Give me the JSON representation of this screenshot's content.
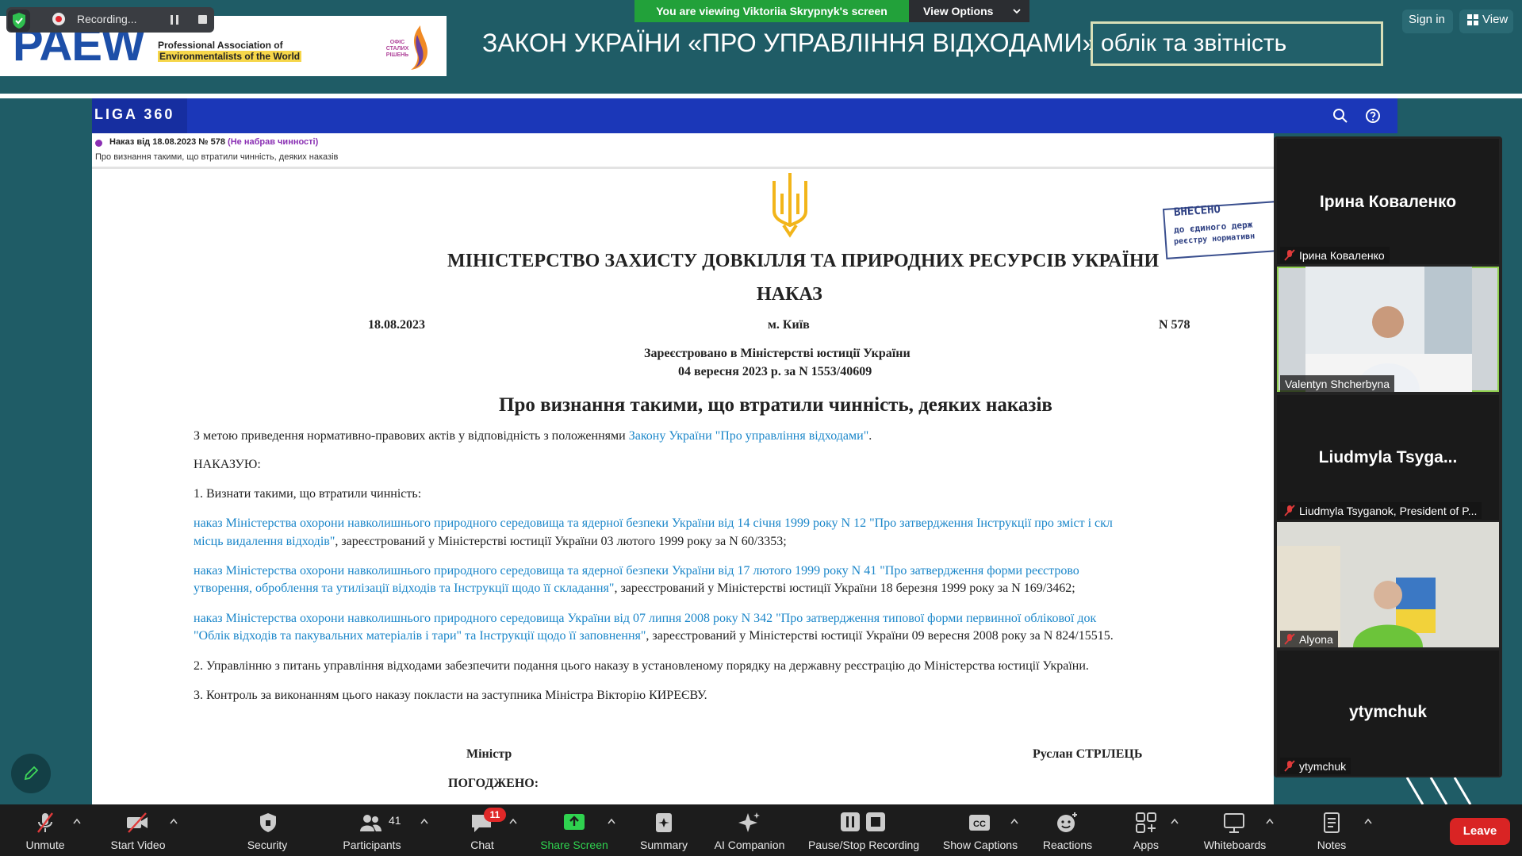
{
  "slide": {
    "logo_text": "PAEW",
    "logo_sub_1": "Professional Association of",
    "logo_sub_2": "Environmentalists of the World",
    "partner_logo_text": "ОФІС СТАЛИХ РІШЕНЬ",
    "title": "ЗАКОН УКРАЇНИ «ПРО УПРАВЛІННЯ ВІДХОДАМИ»:",
    "subtitle": "облік та звітність"
  },
  "overlay": {
    "recording_label": "Recording...",
    "viewing_text": "You are viewing Viktoriia Skrypnyk's screen",
    "view_options_label": "View Options",
    "sign_in_label": "Sign in",
    "view_label": "View"
  },
  "liga": {
    "brand": "LIGA 360",
    "order_line": "Наказ від 18.08.2023 № 578",
    "order_status": "(Не набрав чинності)",
    "order_desc": "Про визнання такими, що втратили чинність, деяких наказів"
  },
  "document": {
    "ministry_title": "МІНІСТЕРСТВО ЗАХИСТУ ДОВКІЛЛЯ ТА ПРИРОДНИХ РЕСУРСІВ УКРАЇНИ",
    "nakaz_title": "НАКАЗ",
    "date": "18.08.2023",
    "city": "м. Київ",
    "number": "N 578",
    "reg_line1": "Зареєстровано в Міністерстві юстиції України",
    "reg_line2": "04 вересня 2023 р. за N 1553/40609",
    "heading": "Про визнання такими, що втратили чинність, деяких наказів",
    "p_intro_text": "З метою приведення нормативно-правових актів у відповідність з положеннями ",
    "p_intro_link": "Закону України \"Про управління відходами\"",
    "p_intro_end": ".",
    "p_nakazuyu": "НАКАЗУЮ:",
    "p_item1": "1. Визнати такими, що втратили чинність:",
    "p_a1_link": "наказ Міністерства охорони навколишнього природного середовища та ядерної безпеки України від 14 січня 1999 року N 12 \"Про затвердження Інструкції про зміст і скл",
    "p_a2_link": "місць видалення відходів\"",
    "p_a2_text": ", зареєстрований у Міністерстві юстиції України 03 лютого 1999 року за N 60/3353;",
    "p_b1_link": "наказ Міністерства охорони навколишнього природного середовища та ядерної безпеки України від 17 лютого 1999 року N 41 \"Про затвердження форми реєстрово",
    "p_b2_link": "утворення, оброблення та утилізації відходів та Інструкції щодо її складання\"",
    "p_b2_text": ", зареєстрований у Міністерстві юстиції України 18 березня 1999 року за N 169/3462;",
    "p_c1_link": "наказ Міністерства охорони навколишнього природного середовища України від 07 липня 2008 року N 342 \"Про затвердження типової форми первинної облікової док",
    "p_c2_link": "\"Облік відходів та пакувальних матеріалів і тари\" та Інструкції щодо її заповнення\"",
    "p_c2_text": ", зареєстрований у Міністерстві юстиції України 09 вересня 2008 року за N 824/15515.",
    "p_item2": "2. Управлінню з питань управління відходами забезпечити подання цього наказу в установленому порядку на державну реєстрацію до Міністерства юстиції України.",
    "p_item3": "3. Контроль за виконанням цього наказу покласти на заступника Міністра Вікторію КИРЕЄВУ.",
    "minister_label": "Міністр",
    "minister_name": "Руслан СТРІЛЕЦЬ",
    "agreed_label": "ПОГОДЖЕНО:",
    "stamp_l1": "ВНЕСЕНО",
    "stamp_l2": "до єдиного держ",
    "stamp_l3": "реєстру нормативн"
  },
  "participants": [
    {
      "big_name": "Ірина Коваленко",
      "label": "Ірина Коваленко"
    },
    {
      "big_name": "",
      "label": "Valentyn Shcherbyna"
    },
    {
      "big_name": "Liudmyla  Tsyga...",
      "label": "Liudmyla Tsyganok, President of P..."
    },
    {
      "big_name": "",
      "label": "Alyona"
    },
    {
      "big_name": "ytymchuk",
      "label": "ytymchuk"
    }
  ],
  "toolbar": {
    "unmute": "Unmute",
    "start_video": "Start Video",
    "security": "Security",
    "participants": "Participants",
    "participants_count": "41",
    "chat": "Chat",
    "chat_badge": "11",
    "share_screen": "Share Screen",
    "summary": "Summary",
    "ai_companion": "AI Companion",
    "pause_stop_recording": "Pause/Stop Recording",
    "show_captions": "Show Captions",
    "reactions": "Reactions",
    "apps": "Apps",
    "whiteboards": "Whiteboards",
    "notes": "Notes",
    "leave": "Leave"
  },
  "colors": {
    "background": "#1f5c66",
    "liga_blue": "#1b37b8",
    "link_blue": "#1a86c9",
    "share_green": "#2fd24f",
    "leave_red": "#d92424",
    "banner_green": "#22a13a"
  }
}
